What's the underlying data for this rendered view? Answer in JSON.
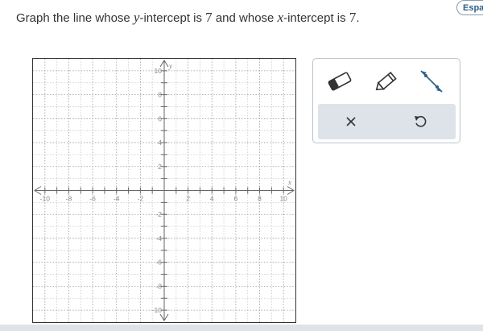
{
  "language_button": {
    "label": "Español"
  },
  "prompt": {
    "part1": "Graph the line whose ",
    "var_y": "y",
    "part2": "-intercept is ",
    "num1": "7",
    "part3": " and whose ",
    "var_x": "x",
    "part4": "-intercept is ",
    "num2": "7",
    "part5": "."
  },
  "graph": {
    "x_axis_label": "x",
    "y_axis_label": "y",
    "x_range": [
      -11,
      11
    ],
    "y_range": [
      -11,
      11
    ],
    "tick_labels": [
      -10,
      -8,
      -6,
      -4,
      -2,
      2,
      4,
      6,
      8,
      10
    ]
  },
  "tools": {
    "eraser": "eraser-icon",
    "pencil": "pencil-icon",
    "line": "line-segment-icon",
    "clear": "x-icon",
    "undo": "undo-icon"
  },
  "colors": {
    "accent": "#2b5f86",
    "tool_row_bg": "#dde3e8",
    "grid_minor": "#c8c8c8",
    "grid_major": "#9a9a9a"
  }
}
